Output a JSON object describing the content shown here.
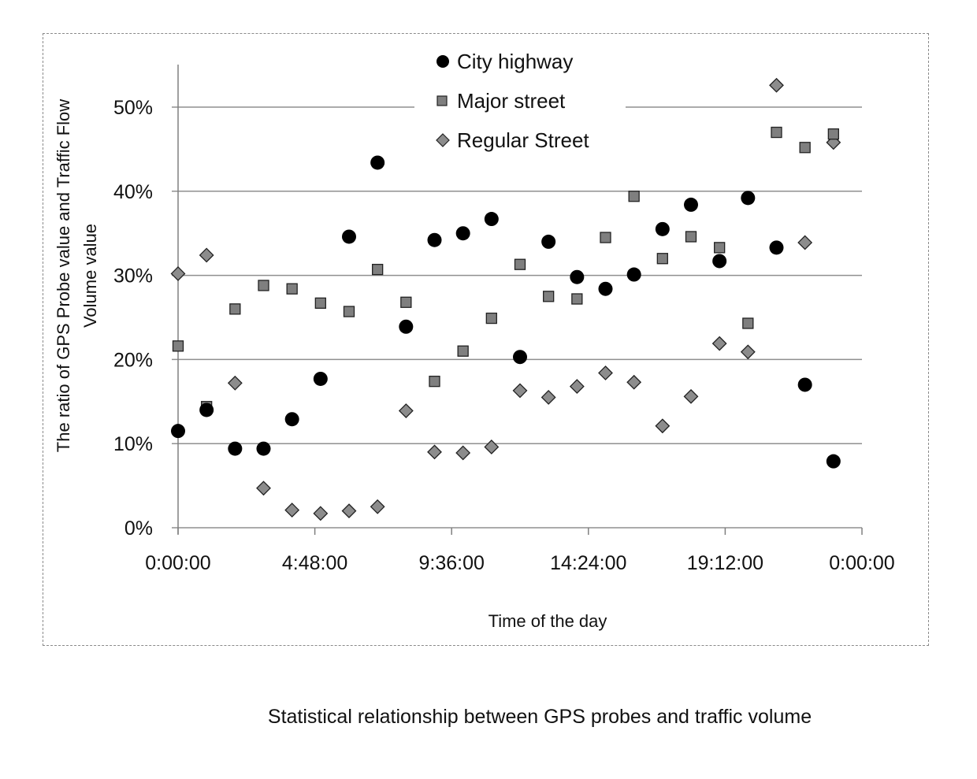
{
  "caption": "Statistical relationship between GPS probes and traffic volume",
  "chart_data": {
    "type": "scatter",
    "title": "",
    "xlabel": "Time of the day",
    "ylabel": "The ratio of GPS Probe value and Traffic Flow Volume value",
    "ylabel_lines": [
      "The ratio of GPS Probe value and Traffic Flow",
      "Volume value"
    ],
    "x_unit": "hours",
    "xlim": [
      0,
      24
    ],
    "ylim": [
      0,
      0.5
    ],
    "x_ticks": [
      0,
      4.8,
      9.6,
      14.4,
      19.2,
      24
    ],
    "x_tick_labels": [
      "0:00:00",
      "4:48:00",
      "9:36:00",
      "14:24:00",
      "19:12:00",
      "0:00:00"
    ],
    "y_ticks": [
      0,
      0.1,
      0.2,
      0.3,
      0.4,
      0.5
    ],
    "y_tick_labels": [
      "0%",
      "10%",
      "20%",
      "30%",
      "40%",
      "50%"
    ],
    "grid": "horizontal",
    "legend_position": "top-center",
    "x": [
      0,
      1,
      2,
      3,
      4,
      5,
      6,
      7,
      8,
      9,
      10,
      11,
      12,
      13,
      14,
      15,
      16,
      17,
      18,
      19,
      20,
      21,
      22,
      23
    ],
    "series": [
      {
        "name": "City highway",
        "marker": "circle",
        "color": "#000000",
        "values": [
          0.115,
          0.14,
          0.094,
          0.094,
          0.129,
          0.177,
          0.346,
          0.434,
          0.239,
          0.342,
          0.35,
          0.367,
          0.203,
          0.34,
          0.298,
          0.284,
          0.301,
          0.355,
          0.384,
          0.317,
          0.392,
          0.333,
          0.17,
          0.079
        ]
      },
      {
        "name": "Major street",
        "marker": "square",
        "color": "#7f7f7f",
        "values": [
          0.216,
          0.144,
          0.26,
          0.288,
          0.284,
          0.267,
          0.257,
          0.307,
          0.268,
          0.174,
          0.21,
          0.249,
          0.313,
          0.275,
          0.272,
          0.345,
          0.394,
          0.32,
          0.346,
          0.333,
          0.243,
          0.47,
          0.452,
          0.468
        ]
      },
      {
        "name": "Regular Street",
        "marker": "diamond",
        "color": "#8c8c8c",
        "values": [
          0.302,
          0.324,
          0.172,
          0.047,
          0.021,
          0.017,
          0.02,
          0.025,
          0.139,
          0.09,
          0.089,
          0.096,
          0.163,
          0.155,
          0.168,
          0.184,
          0.173,
          0.121,
          0.156,
          0.219,
          0.209,
          0.526,
          0.339,
          0.458
        ]
      }
    ]
  }
}
